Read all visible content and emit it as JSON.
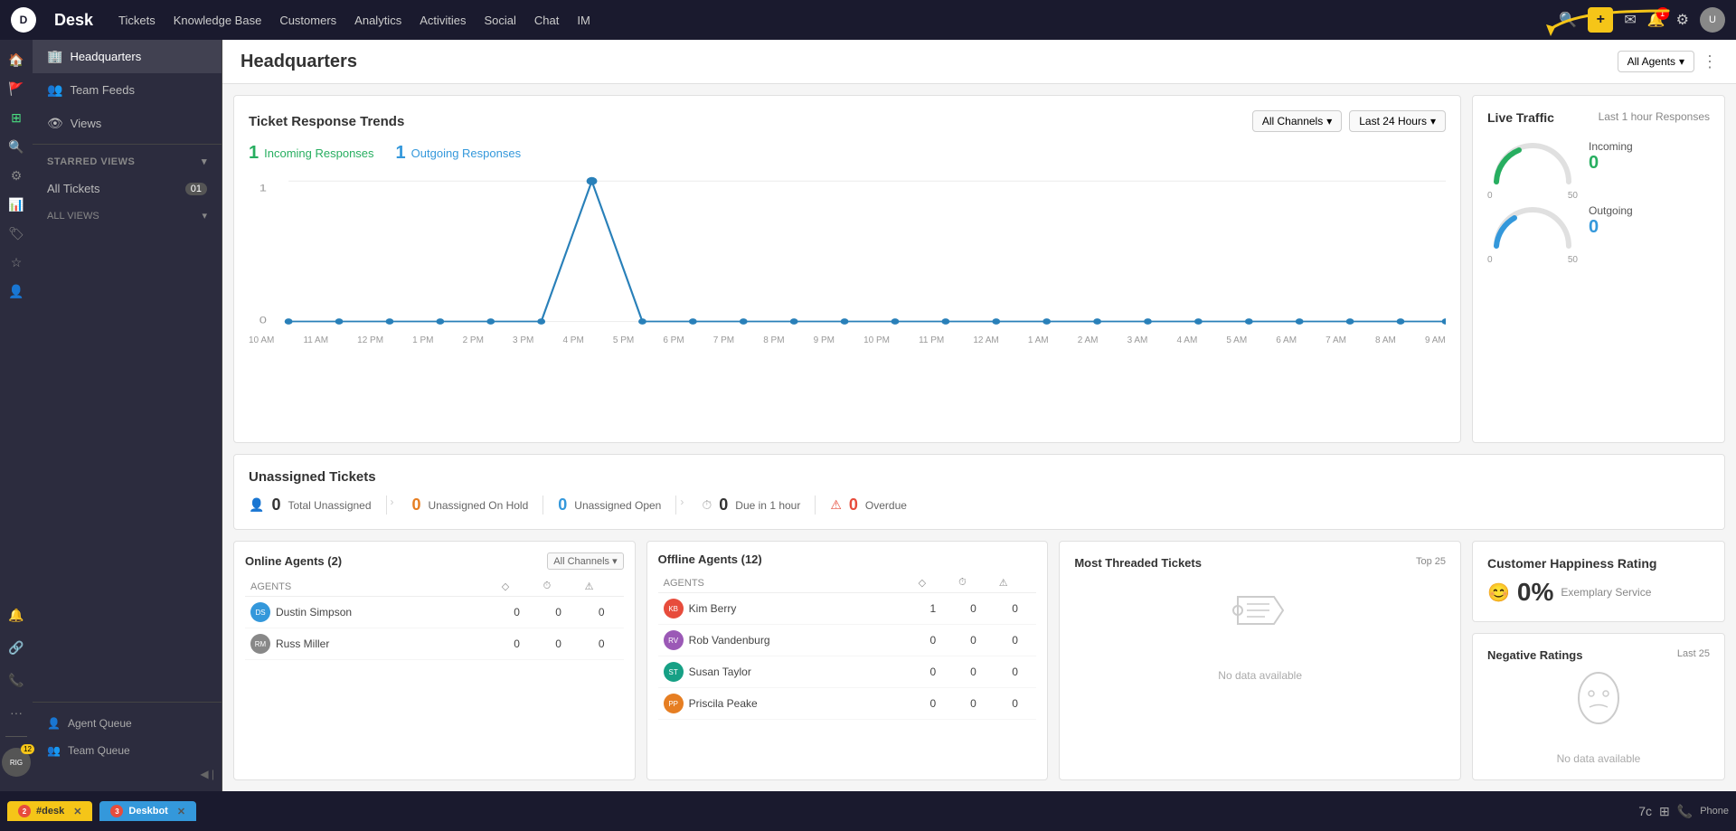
{
  "app": {
    "name": "Desk",
    "logo_text": "D"
  },
  "top_nav": {
    "items": [
      "Tickets",
      "Knowledge Base",
      "Customers",
      "Analytics",
      "Activities",
      "Social",
      "Chat",
      "IM"
    ]
  },
  "sidebar": {
    "headquarters_label": "Headquarters",
    "team_feeds_label": "Team Feeds",
    "views_label": "Views",
    "starred_views_label": "STARRED VIEWS",
    "all_tickets_label": "All Tickets",
    "all_tickets_count": "01",
    "all_views_label": "ALL VIEWS",
    "agent_queue_label": "Agent Queue",
    "team_queue_label": "Team Queue",
    "agent_badge": "12"
  },
  "page": {
    "title": "Headquarters",
    "agents_btn": "All Agents",
    "more_icon": "⋮"
  },
  "trends": {
    "title": "Ticket Response Trends",
    "filter_channels": "All Channels",
    "filter_time": "Last 24 Hours",
    "incoming_count": "1",
    "incoming_label": "Incoming Responses",
    "outgoing_count": "1",
    "outgoing_label": "Outgoing Responses",
    "time_labels": [
      "10 AM",
      "11 AM",
      "12 PM",
      "1 PM",
      "2 PM",
      "3 PM",
      "4 PM",
      "5 PM",
      "6 PM",
      "7 PM",
      "8 PM",
      "9 PM",
      "10 PM",
      "11 PM",
      "12 AM",
      "1 AM",
      "2 AM",
      "3 AM",
      "4 AM",
      "5 AM",
      "6 AM",
      "7 AM",
      "8 AM",
      "9 AM"
    ]
  },
  "live_traffic": {
    "title": "Live Traffic",
    "subtitle": "Last 1 hour Responses",
    "incoming_label": "Incoming",
    "incoming_value": "0",
    "outgoing_label": "Outgoing",
    "outgoing_value": "0",
    "gauge_min": "0",
    "gauge_max": "50"
  },
  "unassigned": {
    "title": "Unassigned Tickets",
    "total_label": "Total Unassigned",
    "total_value": "0",
    "on_hold_label": "Unassigned On Hold",
    "on_hold_value": "0",
    "open_label": "Unassigned Open",
    "open_value": "0",
    "due_label": "Due in 1 hour",
    "due_value": "0",
    "overdue_label": "Overdue",
    "overdue_value": "0"
  },
  "online_agents": {
    "title": "Online Agents (2)",
    "filter": "All Channels",
    "col_agents": "AGENTS",
    "col_ticket": "◇",
    "col_clock": "⏱",
    "col_alert": "⚠",
    "agents": [
      {
        "initials": "DS",
        "name": "Dustin Simpson",
        "v1": "0",
        "v2": "0",
        "v3": "0",
        "color": "#3498db"
      },
      {
        "initials": "RM",
        "name": "Russ Miller",
        "v1": "0",
        "v2": "0",
        "v3": "0",
        "color": "#888",
        "has_avatar": true
      }
    ]
  },
  "offline_agents": {
    "title": "Offline Agents (12)",
    "col_agents": "AGENTS",
    "col_ticket": "◇",
    "col_clock": "⏱",
    "col_alert": "⚠",
    "agents": [
      {
        "initials": "KB",
        "name": "Kim Berry",
        "v1": "1",
        "v2": "0",
        "v3": "0",
        "color": "#e74c3c"
      },
      {
        "initials": "RV",
        "name": "Rob Vandenburg",
        "v1": "0",
        "v2": "0",
        "v3": "0",
        "color": "#9b59b6"
      },
      {
        "initials": "ST",
        "name": "Susan Taylor",
        "v1": "0",
        "v2": "0",
        "v3": "0",
        "color": "#16a085"
      },
      {
        "initials": "PP",
        "name": "Priscila Peake",
        "v1": "0",
        "v2": "0",
        "v3": "0",
        "color": "#e67e22"
      }
    ]
  },
  "threaded": {
    "title": "Most Threaded Tickets",
    "subtitle": "Top 25",
    "no_data": "No data available"
  },
  "happiness": {
    "title": "Customer Happiness Rating",
    "value": "0%",
    "label": "Exemplary Service"
  },
  "negative": {
    "title": "Negative Ratings",
    "subtitle": "Last 25",
    "no_data": "No data available"
  },
  "bottom_tabs": [
    {
      "label": "#desk",
      "badge": "2",
      "color": "yellow"
    },
    {
      "label": "Deskbot",
      "badge": "3",
      "color": "blue"
    }
  ],
  "bottom_right": {
    "label": "Phone"
  }
}
